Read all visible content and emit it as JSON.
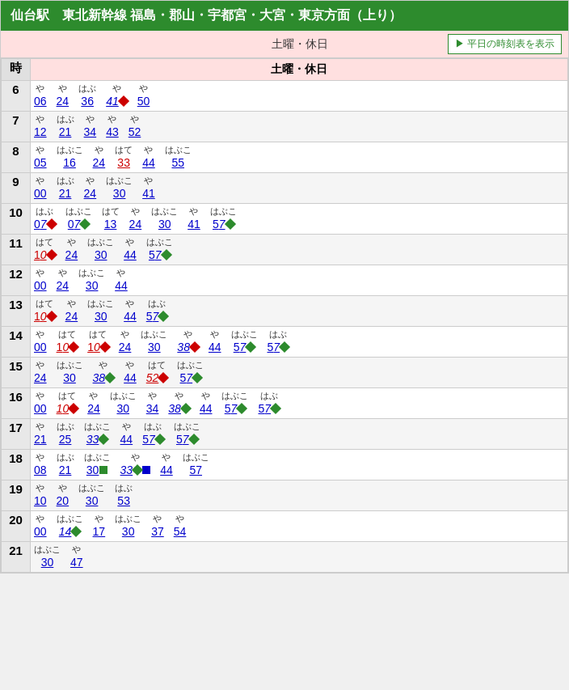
{
  "header": {
    "title": "仙台駅　東北新幹線 福島・郡山・宇都宮・大宮・東京方面（上り）"
  },
  "subheader": {
    "tab": "土曜・休日",
    "weekday_btn": "▶ 平日の時刻表を表示"
  },
  "col_headers": [
    "時",
    "土曜・休日"
  ],
  "hours": [
    6,
    7,
    8,
    9,
    10,
    11,
    12,
    13,
    14,
    15,
    16,
    17,
    18,
    19,
    20,
    21
  ]
}
